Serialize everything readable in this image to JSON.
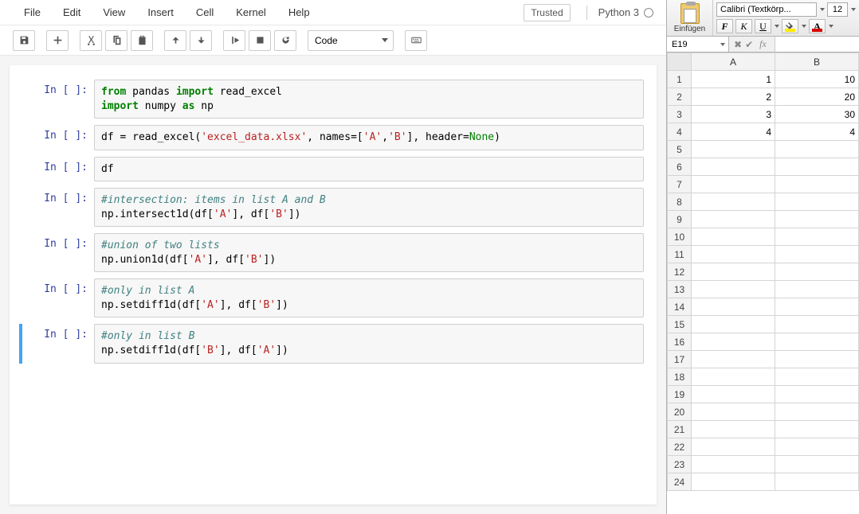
{
  "jupyter": {
    "menu": [
      "File",
      "Edit",
      "View",
      "Insert",
      "Cell",
      "Kernel",
      "Help"
    ],
    "trusted": "Trusted",
    "kernel": "Python 3",
    "cell_type": "Code",
    "prompt_prefix": "In [ ]:",
    "cells": [
      {
        "lines": [
          {
            "segs": [
              {
                "t": "from",
                "c": "kw-green"
              },
              {
                "t": " pandas "
              },
              {
                "t": "import",
                "c": "kw-green"
              },
              {
                "t": " read_excel"
              }
            ]
          },
          {
            "segs": [
              {
                "t": "import",
                "c": "kw-green"
              },
              {
                "t": " numpy "
              },
              {
                "t": "as",
                "c": "kw-green"
              },
              {
                "t": " np"
              }
            ]
          }
        ]
      },
      {
        "lines": [
          {
            "segs": [
              {
                "t": "df = read_excel("
              },
              {
                "t": "'excel_data.xlsx'",
                "c": "str-red"
              },
              {
                "t": ", names=["
              },
              {
                "t": "'A'",
                "c": "str-red"
              },
              {
                "t": ","
              },
              {
                "t": "'B'",
                "c": "str-red"
              },
              {
                "t": "], header="
              },
              {
                "t": "None",
                "c": "val-green"
              },
              {
                "t": ")"
              }
            ]
          }
        ]
      },
      {
        "lines": [
          {
            "segs": [
              {
                "t": "df"
              }
            ]
          }
        ]
      },
      {
        "lines": [
          {
            "segs": [
              {
                "t": "#intersection: items in list A and B",
                "c": "comment"
              }
            ]
          },
          {
            "segs": [
              {
                "t": "np.intersect1d(df["
              },
              {
                "t": "'A'",
                "c": "str-red"
              },
              {
                "t": "], df["
              },
              {
                "t": "'B'",
                "c": "str-red"
              },
              {
                "t": "])"
              }
            ]
          }
        ]
      },
      {
        "lines": [
          {
            "segs": [
              {
                "t": "#union of two lists",
                "c": "comment"
              }
            ]
          },
          {
            "segs": [
              {
                "t": "np.union1d(df["
              },
              {
                "t": "'A'",
                "c": "str-red"
              },
              {
                "t": "], df["
              },
              {
                "t": "'B'",
                "c": "str-red"
              },
              {
                "t": "])"
              }
            ]
          }
        ]
      },
      {
        "lines": [
          {
            "segs": [
              {
                "t": "#only in list A",
                "c": "comment"
              }
            ]
          },
          {
            "segs": [
              {
                "t": "np.setdiff1d(df["
              },
              {
                "t": "'A'",
                "c": "str-red"
              },
              {
                "t": "], df["
              },
              {
                "t": "'B'",
                "c": "str-red"
              },
              {
                "t": "])"
              }
            ]
          }
        ]
      },
      {
        "selected": true,
        "lines": [
          {
            "segs": [
              {
                "t": "#only in list B",
                "c": "comment"
              }
            ]
          },
          {
            "segs": [
              {
                "t": "np.setdiff1d(df["
              },
              {
                "t": "'B'",
                "c": "str-red"
              },
              {
                "t": "], df["
              },
              {
                "t": "'A'",
                "c": "str-red"
              },
              {
                "t": "])"
              }
            ]
          }
        ]
      }
    ]
  },
  "excel": {
    "paste_label": "Einfügen",
    "font_name": "Calibri (Textkörp...",
    "font_size": "12",
    "bold": "F",
    "italic": "K",
    "underline": "U",
    "font_color_letter": "A",
    "cell_ref": "E19",
    "columns": [
      "A",
      "B"
    ],
    "rows": [
      {
        "n": 1,
        "A": "1",
        "B": "10"
      },
      {
        "n": 2,
        "A": "2",
        "B": "20"
      },
      {
        "n": 3,
        "A": "3",
        "B": "30"
      },
      {
        "n": 4,
        "A": "4",
        "B": "4"
      },
      {
        "n": 5,
        "A": "",
        "B": ""
      },
      {
        "n": 6,
        "A": "",
        "B": ""
      },
      {
        "n": 7,
        "A": "",
        "B": ""
      },
      {
        "n": 8,
        "A": "",
        "B": ""
      },
      {
        "n": 9,
        "A": "",
        "B": ""
      },
      {
        "n": 10,
        "A": "",
        "B": ""
      },
      {
        "n": 11,
        "A": "",
        "B": ""
      },
      {
        "n": 12,
        "A": "",
        "B": ""
      },
      {
        "n": 13,
        "A": "",
        "B": ""
      },
      {
        "n": 14,
        "A": "",
        "B": ""
      },
      {
        "n": 15,
        "A": "",
        "B": ""
      },
      {
        "n": 16,
        "A": "",
        "B": ""
      },
      {
        "n": 17,
        "A": "",
        "B": ""
      },
      {
        "n": 18,
        "A": "",
        "B": ""
      },
      {
        "n": 19,
        "A": "",
        "B": ""
      },
      {
        "n": 20,
        "A": "",
        "B": ""
      },
      {
        "n": 21,
        "A": "",
        "B": ""
      },
      {
        "n": 22,
        "A": "",
        "B": ""
      },
      {
        "n": 23,
        "A": "",
        "B": ""
      },
      {
        "n": 24,
        "A": "",
        "B": ""
      }
    ]
  }
}
